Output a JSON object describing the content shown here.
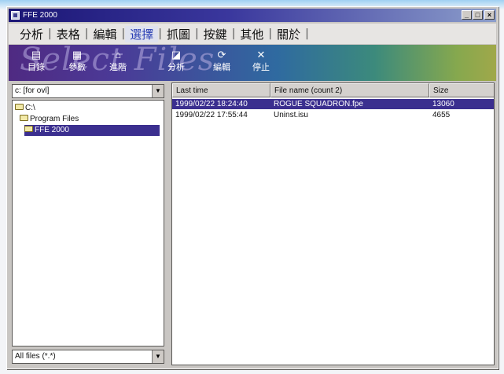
{
  "window": {
    "title": "FFE 2000",
    "controls": {
      "minimize": "_",
      "maximize": "□",
      "close": "×"
    }
  },
  "menu": {
    "items": [
      {
        "label": "分析",
        "active": false
      },
      {
        "label": "表格",
        "active": false
      },
      {
        "label": "編輯",
        "active": false
      },
      {
        "label": "選擇",
        "active": true
      },
      {
        "label": "抓圖",
        "active": false
      },
      {
        "label": "按鍵",
        "active": false
      },
      {
        "label": "其他",
        "active": false
      },
      {
        "label": "關於",
        "active": false
      }
    ]
  },
  "toolbar": {
    "banner": "Select Files",
    "buttons": [
      {
        "label": "目錄",
        "icon": "directory-icon",
        "glyph": "▤"
      },
      {
        "label": "參數",
        "icon": "parameter-icon",
        "glyph": "▦"
      },
      {
        "label": "進階",
        "icon": "advanced-icon",
        "glyph": "⌂"
      },
      {
        "label": "分析",
        "icon": "analyze-icon",
        "glyph": "◪"
      },
      {
        "label": "編輯",
        "icon": "edit-icon",
        "glyph": "⟳"
      },
      {
        "label": "停止",
        "icon": "stop-icon",
        "glyph": "✕"
      }
    ]
  },
  "drive_select": {
    "value": "c: [for ovl]"
  },
  "tree": {
    "nodes": [
      {
        "label": "C:\\",
        "level": 0,
        "selected": false
      },
      {
        "label": "Program Files",
        "level": 1,
        "selected": false
      },
      {
        "label": "FFE 2000",
        "level": 2,
        "selected": true
      }
    ]
  },
  "filter_select": {
    "value": "All files (*.*)"
  },
  "file_list": {
    "columns": [
      "Last time",
      "File name (count 2)",
      "Size"
    ],
    "rows": [
      {
        "time": "1999/02/22 18:24:40",
        "name": "ROGUE SQUADRON.fpe",
        "size": "13060",
        "selected": true
      },
      {
        "time": "1999/02/22 17:55:44",
        "name": "Uninst.isu",
        "size": "4655",
        "selected": false
      }
    ]
  },
  "colors": {
    "title_start": "#1b1675",
    "selection": "#3b2f8f",
    "active_menu": "#2a3fb4"
  }
}
